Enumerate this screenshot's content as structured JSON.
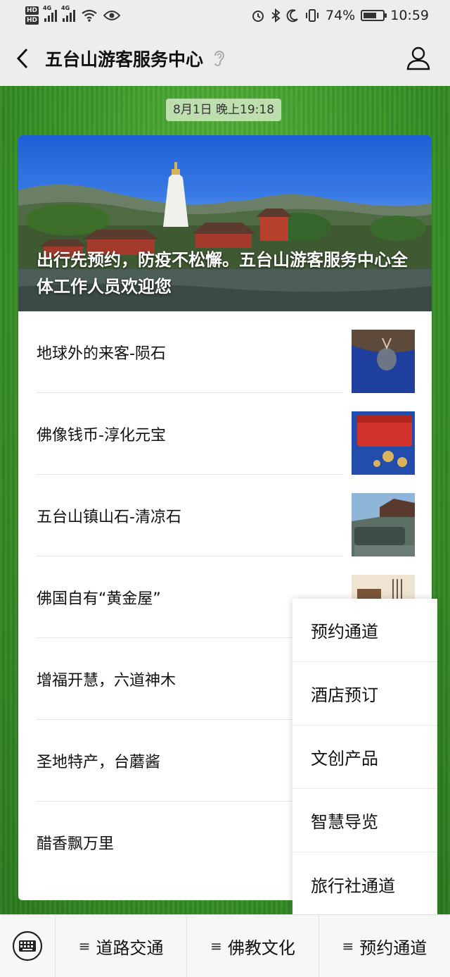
{
  "status_bar": {
    "hd1": "HD",
    "hd2": "HD",
    "net1": "4G",
    "net2": "4G",
    "battery_percent": "74%",
    "time": "10:59",
    "icons": [
      "alarm-icon",
      "bluetooth-icon",
      "moon-icon",
      "vibrate-icon",
      "battery-icon",
      "wifi-icon",
      "eye-icon"
    ]
  },
  "header": {
    "title": "五台山游客服务中心",
    "back_icon": "chevron-left-icon",
    "profile_icon": "person-icon",
    "ear_icon": "ear-icon"
  },
  "chat": {
    "timestamp": "8月1日 晚上19:18",
    "card": {
      "cover_title": "出行先预约，防疫不松懈。五台山游客服务中心全体工作人员欢迎您",
      "articles": [
        {
          "title": "地球外的来客-陨石"
        },
        {
          "title": "佛像钱币-淳化元宝"
        },
        {
          "title": "五台山镇山石-清凉石"
        },
        {
          "title": "佛国自有“黄金屋”"
        },
        {
          "title": "增福开慧，六道神木"
        },
        {
          "title": "圣地特产，台蘑酱"
        },
        {
          "title": "醋香飘万里"
        }
      ]
    }
  },
  "popup_menu": {
    "items": [
      {
        "label": "预约通道"
      },
      {
        "label": "酒店预订"
      },
      {
        "label": "文创产品"
      },
      {
        "label": "智慧导览"
      },
      {
        "label": "旅行社通道"
      }
    ]
  },
  "bottom_menu": {
    "keyboard_icon": "keyboard-icon",
    "items": [
      {
        "label": "道路交通",
        "icon": "menu-lines-icon"
      },
      {
        "label": "佛教文化",
        "icon": "menu-lines-icon"
      },
      {
        "label": "预约通道",
        "icon": "menu-lines-icon"
      }
    ]
  },
  "colors": {
    "chat_background": "#3c9a2a",
    "bar_background": "#ededed",
    "timestamp_bg": "#cde6be"
  }
}
